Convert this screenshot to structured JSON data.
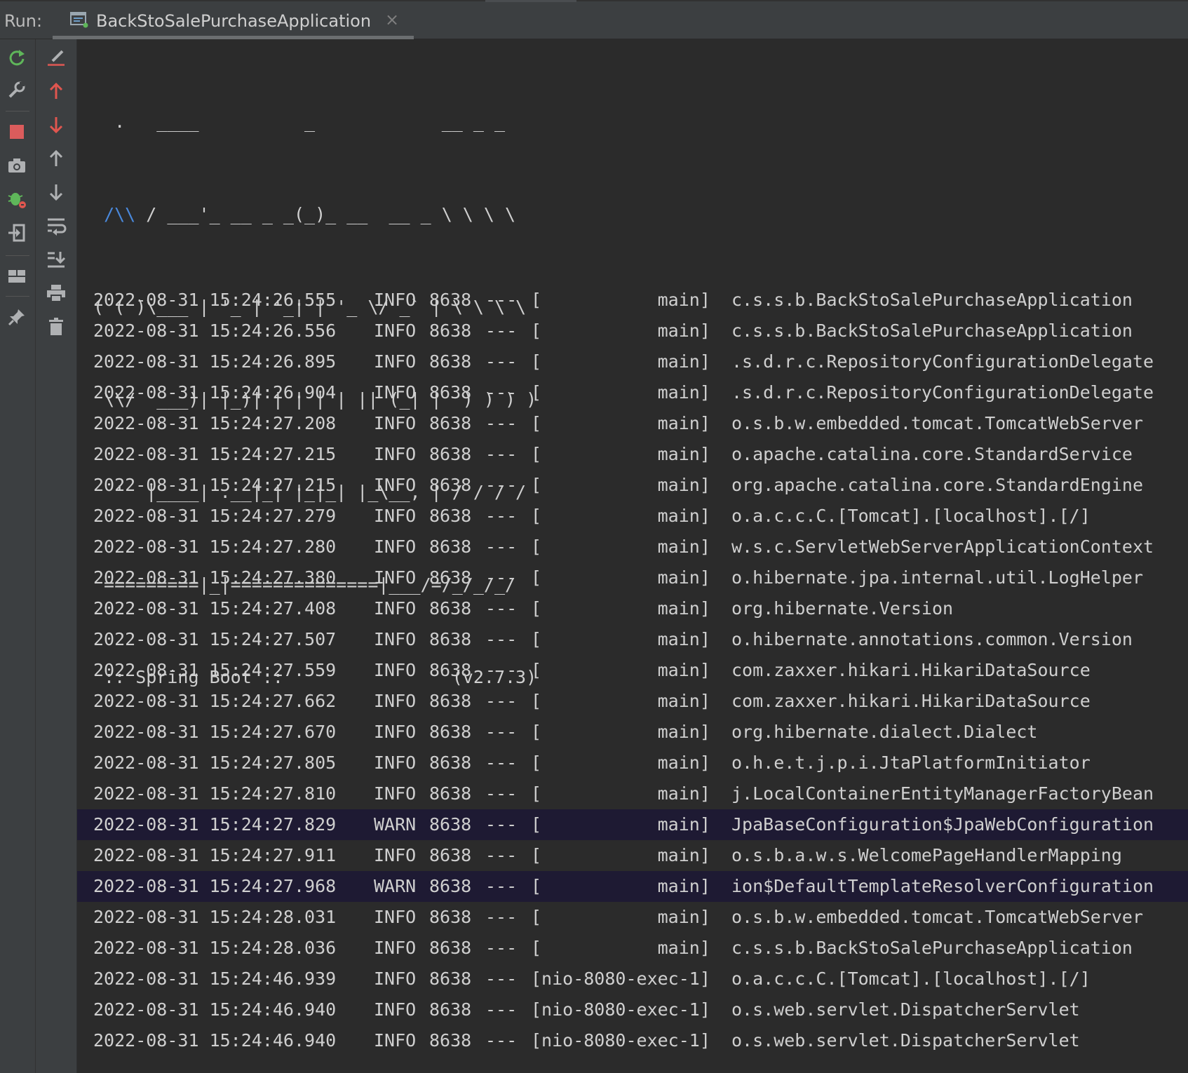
{
  "run_panel": {
    "label": "Run:",
    "tab_title": "BackStoSalePurchaseApplication",
    "tab_close": "×"
  },
  "left_toolbar": [
    {
      "name": "rerun-icon",
      "color": "#5fb65a"
    },
    {
      "name": "wrench-icon",
      "color": "#afb1b3"
    },
    {
      "name": "stop-icon",
      "color": "#db5c5c"
    },
    {
      "name": "camera-icon",
      "color": "#afb1b3"
    },
    {
      "name": "bug-icon",
      "color": "#5fb65a"
    },
    {
      "name": "exit-icon",
      "color": "#afb1b3"
    },
    {
      "name": "layout-icon",
      "color": "#afb1b3"
    },
    {
      "name": "pin-icon",
      "color": "#afb1b3"
    }
  ],
  "second_toolbar": [
    {
      "name": "clear-edit-icon",
      "color": "#c75450"
    },
    {
      "name": "up-red-arrow-icon",
      "color": "#e0564f"
    },
    {
      "name": "down-red-arrow-icon",
      "color": "#e0564f"
    },
    {
      "name": "up-arrow-icon",
      "color": "#afb1b3"
    },
    {
      "name": "down-arrow-icon",
      "color": "#afb1b3"
    },
    {
      "name": "soft-wrap-icon",
      "color": "#afb1b3"
    },
    {
      "name": "scroll-to-end-icon",
      "color": "#afb1b3"
    },
    {
      "name": "print-icon",
      "color": "#afb1b3"
    },
    {
      "name": "trash-icon",
      "color": "#afb1b3"
    }
  ],
  "banner": {
    "line1": "  .   ____          _            __ _ _",
    "line2_lambda": "/\\\\",
    "line2_rest": " / ___'_ __ _ _(_)_ __  __ _ \\ \\ \\ \\",
    "line3": "( ( )\\___ | '_ | '_| | '_ \\/ _` | \\ \\ \\ \\",
    "line4": " \\\\/  ___)| |_)| | | | | || (_| |  ) ) ) )",
    "line5": "  '  |____| .__|_| |_|_| |_\\__, | / / / /",
    "line6": " =========|_|==============|___/=/_/_/_/",
    "line7": " :: Spring Boot ::                (v2.7.3)"
  },
  "log": [
    {
      "ts": "2022-08-31 15:24:26.555",
      "level": "INFO",
      "pid": "8638",
      "sep": "---",
      "thread": "[           main]",
      "logger": "c.s.s.b.BackStoSalePurchaseApplication"
    },
    {
      "ts": "2022-08-31 15:24:26.556",
      "level": "INFO",
      "pid": "8638",
      "sep": "---",
      "thread": "[           main]",
      "logger": "c.s.s.b.BackStoSalePurchaseApplication"
    },
    {
      "ts": "2022-08-31 15:24:26.895",
      "level": "INFO",
      "pid": "8638",
      "sep": "---",
      "thread": "[           main]",
      "logger": ".s.d.r.c.RepositoryConfigurationDelegate"
    },
    {
      "ts": "2022-08-31 15:24:26.904",
      "level": "INFO",
      "pid": "8638",
      "sep": "---",
      "thread": "[           main]",
      "logger": ".s.d.r.c.RepositoryConfigurationDelegate"
    },
    {
      "ts": "2022-08-31 15:24:27.208",
      "level": "INFO",
      "pid": "8638",
      "sep": "---",
      "thread": "[           main]",
      "logger": "o.s.b.w.embedded.tomcat.TomcatWebServer"
    },
    {
      "ts": "2022-08-31 15:24:27.215",
      "level": "INFO",
      "pid": "8638",
      "sep": "---",
      "thread": "[           main]",
      "logger": "o.apache.catalina.core.StandardService"
    },
    {
      "ts": "2022-08-31 15:24:27.215",
      "level": "INFO",
      "pid": "8638",
      "sep": "---",
      "thread": "[           main]",
      "logger": "org.apache.catalina.core.StandardEngine"
    },
    {
      "ts": "2022-08-31 15:24:27.279",
      "level": "INFO",
      "pid": "8638",
      "sep": "---",
      "thread": "[           main]",
      "logger": "o.a.c.c.C.[Tomcat].[localhost].[/]"
    },
    {
      "ts": "2022-08-31 15:24:27.280",
      "level": "INFO",
      "pid": "8638",
      "sep": "---",
      "thread": "[           main]",
      "logger": "w.s.c.ServletWebServerApplicationContext"
    },
    {
      "ts": "2022-08-31 15:24:27.380",
      "level": "INFO",
      "pid": "8638",
      "sep": "---",
      "thread": "[           main]",
      "logger": "o.hibernate.jpa.internal.util.LogHelper"
    },
    {
      "ts": "2022-08-31 15:24:27.408",
      "level": "INFO",
      "pid": "8638",
      "sep": "---",
      "thread": "[           main]",
      "logger": "org.hibernate.Version"
    },
    {
      "ts": "2022-08-31 15:24:27.507",
      "level": "INFO",
      "pid": "8638",
      "sep": "---",
      "thread": "[           main]",
      "logger": "o.hibernate.annotations.common.Version"
    },
    {
      "ts": "2022-08-31 15:24:27.559",
      "level": "INFO",
      "pid": "8638",
      "sep": "---",
      "thread": "[           main]",
      "logger": "com.zaxxer.hikari.HikariDataSource"
    },
    {
      "ts": "2022-08-31 15:24:27.662",
      "level": "INFO",
      "pid": "8638",
      "sep": "---",
      "thread": "[           main]",
      "logger": "com.zaxxer.hikari.HikariDataSource"
    },
    {
      "ts": "2022-08-31 15:24:27.670",
      "level": "INFO",
      "pid": "8638",
      "sep": "---",
      "thread": "[           main]",
      "logger": "org.hibernate.dialect.Dialect"
    },
    {
      "ts": "2022-08-31 15:24:27.805",
      "level": "INFO",
      "pid": "8638",
      "sep": "---",
      "thread": "[           main]",
      "logger": "o.h.e.t.j.p.i.JtaPlatformInitiator"
    },
    {
      "ts": "2022-08-31 15:24:27.810",
      "level": "INFO",
      "pid": "8638",
      "sep": "---",
      "thread": "[           main]",
      "logger": "j.LocalContainerEntityManagerFactoryBean"
    },
    {
      "ts": "2022-08-31 15:24:27.829",
      "level": "WARN",
      "pid": "8638",
      "sep": "---",
      "thread": "[           main]",
      "logger": "JpaBaseConfiguration$JpaWebConfiguration"
    },
    {
      "ts": "2022-08-31 15:24:27.911",
      "level": "INFO",
      "pid": "8638",
      "sep": "---",
      "thread": "[           main]",
      "logger": "o.s.b.a.w.s.WelcomePageHandlerMapping"
    },
    {
      "ts": "2022-08-31 15:24:27.968",
      "level": "WARN",
      "pid": "8638",
      "sep": "---",
      "thread": "[           main]",
      "logger": "ion$DefaultTemplateResolverConfiguration"
    },
    {
      "ts": "2022-08-31 15:24:28.031",
      "level": "INFO",
      "pid": "8638",
      "sep": "---",
      "thread": "[           main]",
      "logger": "o.s.b.w.embedded.tomcat.TomcatWebServer"
    },
    {
      "ts": "2022-08-31 15:24:28.036",
      "level": "INFO",
      "pid": "8638",
      "sep": "---",
      "thread": "[           main]",
      "logger": "c.s.s.b.BackStoSalePurchaseApplication"
    },
    {
      "ts": "2022-08-31 15:24:46.939",
      "level": "INFO",
      "pid": "8638",
      "sep": "---",
      "thread": "[nio-8080-exec-1]",
      "logger": "o.a.c.c.C.[Tomcat].[localhost].[/]"
    },
    {
      "ts": "2022-08-31 15:24:46.940",
      "level": "INFO",
      "pid": "8638",
      "sep": "---",
      "thread": "[nio-8080-exec-1]",
      "logger": "o.s.web.servlet.DispatcherServlet"
    },
    {
      "ts": "2022-08-31 15:24:46.940",
      "level": "INFO",
      "pid": "8638",
      "sep": "---",
      "thread": "[nio-8080-exec-1]",
      "logger": "o.s.web.servlet.DispatcherServlet"
    }
  ],
  "colors": {
    "background": "#2b2b2b",
    "panel": "#3c3f41",
    "text": "#cfcfcf",
    "warn_row_bg": "#1e1a33",
    "banner_accent": "#4a89dc"
  }
}
